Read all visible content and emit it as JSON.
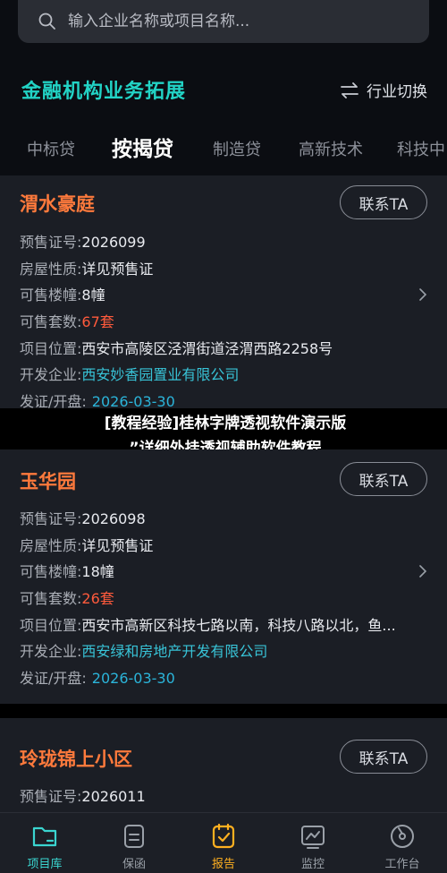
{
  "search": {
    "placeholder": "输入企业名称或项目名称..."
  },
  "section": {
    "title": "金融机构业务拓展",
    "switch_label": "行业切换"
  },
  "tabs": [
    "中标贷",
    "按揭贷",
    "制造贷",
    "高新技术",
    "科技中"
  ],
  "active_tab": "按揭贷",
  "contact_label": "联系TA",
  "labels": {
    "presale": "预售证号:",
    "nature": "房屋性质:",
    "buildings": "可售楼幢:",
    "units": "可售套数:",
    "location": "项目位置:",
    "developer": "开发企业:",
    "issue": "发证/开盘:"
  },
  "cards": [
    {
      "name": "渭水豪庭",
      "presale": "2026099",
      "nature": "详见预售证",
      "buildings": "8幢",
      "units": "67套",
      "location": "西安市高陵区泾渭街道泾渭西路2258号",
      "developer": "西安妙香园置业有限公司",
      "issue": "2026-03-30"
    },
    {
      "name": "玉华园",
      "presale": "2026098",
      "nature": "详见预售证",
      "buildings": "18幢",
      "units": "26套",
      "location": "西安市高新区科技七路以南，科技八路以北，鱼...",
      "developer": "西安绿和房地产开发有限公司",
      "issue": "2026-03-30"
    },
    {
      "name": "玲珑锦上小区",
      "presale": "2026011"
    }
  ],
  "banner": {
    "line1": "[教程经验]桂林字牌透视软件演示版",
    "line2": "”详细外挂透视辅助软件教程"
  },
  "nav": [
    {
      "label": "项目库",
      "icon": "folder-icon"
    },
    {
      "label": "保函",
      "icon": "document-icon"
    },
    {
      "label": "报告",
      "icon": "report-check-icon"
    },
    {
      "label": "监控",
      "icon": "monitor-chart-icon"
    },
    {
      "label": "工作台",
      "icon": "dial-icon"
    }
  ],
  "colors": {
    "accent": "#22d3c5",
    "title_orange": "#ff7a3c",
    "red": "#ff5a3c",
    "link": "#38c4d8",
    "report": "#ffb020"
  }
}
